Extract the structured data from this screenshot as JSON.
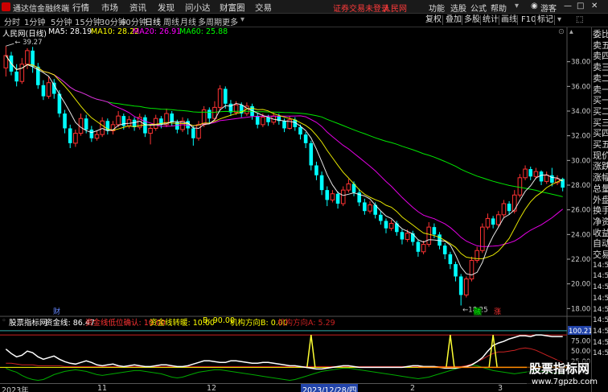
{
  "app": {
    "title": "通达信金融终端",
    "login_notice": "证券交易未登录",
    "user": "人民网",
    "guest": "游客"
  },
  "menu": [
    "行情",
    "市场",
    "资讯",
    "发现",
    "问小达",
    "财富圈",
    "交易"
  ],
  "right_menu": [
    "功能",
    "选股",
    "公式",
    "帮助"
  ],
  "periods": [
    "分时",
    "1分钟",
    "5分钟",
    "15分钟",
    "30分钟",
    "60分钟",
    "日线",
    "周线",
    "月线",
    "多周期",
    "更多"
  ],
  "active_period": "日线",
  "tools": [
    "叠加",
    "多股",
    "统计",
    "画线",
    "F10",
    "标记"
  ],
  "tools_left": "复权",
  "stock": {
    "name": "人民网(日线)"
  },
  "ma": {
    "ma5": {
      "label": "MA5: 28.19",
      "color": "#ffffff"
    },
    "ma10": {
      "label": "MA10: 28.22",
      "color": "#ffff00"
    },
    "ma20": {
      "label": "MA20: 26.91",
      "color": "#ff00ff"
    },
    "ma60": {
      "label": "MA60: 25.88",
      "color": "#00ff00"
    }
  },
  "price_axis": [
    "38.00",
    "36.00",
    "34.00",
    "32.00",
    "30.00",
    "28.00",
    "26.00",
    "24.00",
    "22.00",
    "20.00",
    "18.00"
  ],
  "annotations": {
    "high": "39.27",
    "low": "18.25",
    "cai": "财",
    "rong": "融",
    "zhang": "涨"
  },
  "indicator": {
    "name": "股票指标网",
    "gold_line": "资金线: 86.47",
    "a": "资金线低位确认: 10.00",
    "b": "资金线转暖: 10.00",
    "c": "B: 90.00",
    "d": "机构方向B: 0.00",
    "e": "机构方向A: 5.29",
    "axis": [
      "100.21",
      "75.00",
      "50.00",
      "25.00",
      "0.00"
    ]
  },
  "right_panel": [
    "委比",
    "卖五",
    "卖四",
    "卖三",
    "卖二",
    "卖一",
    "买一",
    "买二",
    "买三",
    "买四",
    "买五",
    "现价",
    "涨跌",
    "涨幅",
    "总量",
    "外盘",
    "换手",
    "净资",
    "收益",
    "自动",
    "交易",
    "14:50",
    "14:50",
    "14:50",
    "14:50",
    "14:50",
    "14:50",
    "14:56",
    "14:56",
    "14:56"
  ],
  "dates": [
    "2023年",
    "11",
    "12",
    "2023/12/28/四",
    "2",
    "3"
  ],
  "watermark": {
    "line1": "股票指标网",
    "line2": "www.7gpzb.com"
  },
  "chart_data": {
    "type": "candlestick",
    "ylim": [
      17.5,
      40
    ],
    "candles": [
      [
        37.5,
        38.5,
        36.8,
        39.27
      ],
      [
        38.5,
        37.2,
        36.9,
        38.8
      ],
      [
        37.2,
        36.4,
        36,
        37.8
      ],
      [
        36.4,
        37.8,
        36.2,
        38.3
      ],
      [
        37.8,
        38.9,
        37.4,
        39.1
      ],
      [
        38.9,
        37.6,
        37.1,
        39.2
      ],
      [
        37.6,
        36.1,
        35.8,
        37.9
      ],
      [
        36.1,
        35.2,
        34.9,
        36.5
      ],
      [
        35.2,
        36.3,
        35,
        36.8
      ],
      [
        36.3,
        35.4,
        35,
        36.6
      ],
      [
        35.4,
        33.8,
        33.5,
        35.7
      ],
      [
        33.8,
        32.6,
        32.2,
        34.1
      ],
      [
        32.6,
        31.4,
        31,
        32.9
      ],
      [
        31.4,
        32.2,
        31.1,
        32.5
      ],
      [
        32.2,
        33.4,
        32,
        33.8
      ],
      [
        33.4,
        32.5,
        32.2,
        33.7
      ],
      [
        32.5,
        31.8,
        31.5,
        32.8
      ],
      [
        31.8,
        32.1,
        31.6,
        32.4
      ],
      [
        32.1,
        33.2,
        31.9,
        33.5
      ],
      [
        33.2,
        32.4,
        32.1,
        33.4
      ],
      [
        32.4,
        32.9,
        32.1,
        33.2
      ],
      [
        32.9,
        33.6,
        32.7,
        34
      ],
      [
        33.6,
        32.8,
        32.5,
        33.8
      ],
      [
        32.8,
        33.3,
        32.6,
        33.6
      ],
      [
        33.3,
        32.7,
        32.4,
        33.5
      ],
      [
        32.7,
        33.5,
        32.5,
        33.8
      ],
      [
        33.5,
        32.2,
        31.9,
        33.7
      ],
      [
        32.2,
        32.6,
        31.3,
        32.9
      ],
      [
        32.6,
        33.4,
        32.4,
        33.7
      ],
      [
        33.4,
        32.9,
        32.6,
        33.6
      ],
      [
        32.9,
        33.8,
        32.7,
        34.2
      ],
      [
        33.8,
        33.1,
        32.8,
        34
      ],
      [
        33.1,
        32.5,
        32.2,
        33.3
      ],
      [
        32.5,
        33.2,
        32.3,
        33.5
      ],
      [
        33.2,
        32.6,
        32.1,
        33.4
      ],
      [
        32.6,
        31.8,
        31.2,
        32.8
      ],
      [
        31.8,
        32.9,
        31.6,
        33.2
      ],
      [
        32.9,
        34.1,
        32.7,
        34.4
      ],
      [
        34.1,
        33.4,
        33,
        34.3
      ],
      [
        33.4,
        34.3,
        33.2,
        34.8
      ],
      [
        34.3,
        35.8,
        34.1,
        36.1
      ],
      [
        35.8,
        34.6,
        34.2,
        36
      ],
      [
        34.6,
        33.9,
        33.6,
        34.9
      ],
      [
        33.9,
        34.5,
        33.7,
        34.8
      ],
      [
        34.5,
        33.8,
        33.5,
        34.7
      ],
      [
        33.8,
        34.4,
        33.6,
        34.7
      ],
      [
        34.4,
        33.6,
        33.3,
        34.6
      ],
      [
        33.6,
        32.9,
        32.6,
        33.8
      ],
      [
        32.9,
        33.5,
        32.7,
        33.8
      ],
      [
        33.5,
        33.1,
        32.8,
        33.7
      ],
      [
        33.1,
        33.6,
        32.9,
        33.9
      ],
      [
        33.6,
        33.2,
        32.9,
        33.8
      ],
      [
        33.2,
        32.6,
        32.3,
        33.4
      ],
      [
        32.6,
        33.3,
        32.5,
        33.6
      ],
      [
        33.3,
        32.7,
        32.4,
        33.5
      ],
      [
        32.7,
        32.1,
        31.7,
        32.9
      ],
      [
        32.1,
        31.4,
        31,
        32.3
      ],
      [
        31.4,
        29.6,
        29.2,
        31.6
      ],
      [
        29.6,
        28.8,
        28.4,
        29.9
      ],
      [
        28.8,
        27.6,
        27.2,
        29.1
      ],
      [
        27.6,
        26.8,
        26.3,
        27.9
      ],
      [
        26.8,
        27.3,
        26.6,
        27.6
      ],
      [
        27.3,
        26.5,
        26.1,
        27.5
      ],
      [
        26.5,
        27.6,
        26.3,
        27.9
      ],
      [
        27.6,
        28.1,
        27.4,
        28.5
      ],
      [
        28.1,
        27.4,
        27.1,
        28.3
      ],
      [
        27.4,
        26.6,
        26.3,
        27.7
      ],
      [
        26.6,
        25.9,
        25.6,
        26.9
      ],
      [
        25.9,
        26.4,
        25.7,
        26.7
      ],
      [
        26.4,
        25.6,
        25.3,
        26.6
      ],
      [
        25.6,
        25.1,
        24.8,
        25.9
      ],
      [
        25.1,
        24.5,
        24.1,
        25.3
      ],
      [
        24.5,
        24.9,
        24.3,
        25.2
      ],
      [
        24.9,
        24.2,
        23.9,
        25.1
      ],
      [
        24.2,
        23.6,
        23.2,
        24.4
      ],
      [
        23.6,
        24.1,
        23.4,
        24.4
      ],
      [
        24.1,
        23.4,
        23.1,
        24.3
      ],
      [
        23.4,
        22.6,
        22.2,
        23.6
      ],
      [
        22.6,
        23.2,
        22.4,
        23.5
      ],
      [
        23.2,
        24.6,
        23,
        25
      ],
      [
        24.6,
        24,
        23.7,
        24.9
      ],
      [
        24,
        23.1,
        22.8,
        24.2
      ],
      [
        23.1,
        22.4,
        22,
        23.3
      ],
      [
        22.4,
        21.6,
        21.2,
        22.6
      ],
      [
        21.6,
        20.6,
        20.2,
        21.8
      ],
      [
        20.6,
        19.1,
        18.25,
        20.8
      ],
      [
        19.1,
        20.4,
        18.9,
        20.6
      ],
      [
        20.4,
        21.9,
        20.2,
        22.2
      ],
      [
        21.9,
        22.7,
        21.7,
        23
      ],
      [
        22.7,
        24.6,
        22.5,
        24.9
      ],
      [
        24.6,
        25.3,
        24.4,
        25.7
      ],
      [
        25.3,
        24.8,
        24.5,
        25.5
      ],
      [
        24.8,
        25.6,
        24.6,
        25.9
      ],
      [
        25.6,
        26.5,
        25.4,
        26.8
      ],
      [
        26.5,
        25.9,
        25.6,
        26.7
      ],
      [
        25.9,
        27.2,
        25.7,
        27.6
      ],
      [
        27.2,
        28.6,
        27,
        28.9
      ],
      [
        28.6,
        29.3,
        28.4,
        29.6
      ],
      [
        29.3,
        28.7,
        28.4,
        29.5
      ],
      [
        28.7,
        29.1,
        28.5,
        29.4
      ],
      [
        29.1,
        28.3,
        28,
        29.2
      ],
      [
        28.3,
        28.8,
        28.1,
        29.1
      ],
      [
        28.8,
        28.2,
        27.9,
        29.4
      ],
      [
        28.2,
        28.5,
        28,
        28.8
      ],
      [
        28.5,
        27.8,
        27.5,
        28.6
      ]
    ],
    "indicator_series": {
      "gold_line": [
        55,
        44,
        36,
        40,
        50,
        46,
        36,
        30,
        34,
        38,
        30,
        24,
        20,
        18,
        22,
        26,
        22,
        16,
        14,
        16,
        18,
        14,
        12,
        14,
        16,
        14,
        12,
        12,
        14,
        16,
        16,
        14,
        12,
        12,
        14,
        18,
        22,
        26,
        26,
        24,
        22,
        22,
        26,
        26,
        24,
        22,
        20,
        20,
        22,
        22,
        20,
        18,
        16,
        14,
        14,
        12,
        10,
        8,
        6,
        6,
        8,
        10,
        12,
        14,
        14,
        12,
        10,
        10,
        10,
        10,
        10,
        10,
        10,
        10,
        10,
        12,
        14,
        14,
        12,
        12,
        12,
        10,
        8,
        8,
        8,
        10,
        12,
        16,
        24,
        34,
        50,
        64,
        70,
        74,
        80,
        84,
        88,
        88,
        86,
        90,
        90,
        88,
        86,
        86,
        86
      ],
      "red_line": [
        20,
        20,
        18,
        16,
        16,
        16,
        14,
        14,
        14,
        14,
        14,
        12,
        12,
        12,
        12,
        12,
        12,
        12,
        12,
        12,
        12,
        12,
        12,
        12,
        12,
        12,
        12,
        12,
        12,
        12,
        12,
        12,
        12,
        12,
        12,
        12,
        12,
        12,
        12,
        12,
        12,
        12,
        12,
        12,
        12,
        12,
        12,
        12,
        12,
        12,
        12,
        12,
        12,
        12,
        12,
        12,
        12,
        12,
        12,
        12,
        12,
        12,
        12,
        12,
        12,
        12,
        12,
        12,
        12,
        12,
        12,
        12,
        12,
        12,
        12,
        12,
        12,
        12,
        12,
        12,
        12,
        12,
        12,
        12,
        12,
        12,
        14,
        18,
        24,
        30,
        38,
        44,
        48,
        48,
        50,
        52,
        56,
        58,
        56,
        52,
        46,
        40,
        34,
        28,
        22
      ],
      "green_line": [
        8,
        2,
        -2,
        -10,
        -16,
        -20,
        -22,
        -20,
        -14,
        -8,
        -4,
        0,
        2,
        4,
        2,
        0,
        -4,
        -8,
        -10,
        -8,
        -6,
        -4,
        -2,
        0,
        2,
        2,
        0,
        -2,
        -4,
        -6,
        -10,
        -14,
        -16,
        -14,
        -10,
        -6,
        -2,
        0,
        2,
        4,
        4,
        2,
        0,
        -2,
        -4,
        -6,
        -8,
        -10,
        -12,
        -14,
        -16,
        -18,
        -20,
        -22,
        -20,
        -16,
        -12,
        -8,
        -4,
        0,
        2,
        4,
        6,
        8,
        8,
        6,
        4,
        2,
        0,
        -2,
        -4,
        -6,
        -8,
        -10,
        -12,
        -14,
        -16,
        -18,
        -16,
        -14,
        -10,
        -6,
        -2,
        2,
        6,
        10,
        14,
        16,
        14,
        10,
        6,
        2,
        0,
        -2,
        -4,
        -6,
        -4,
        -2,
        0,
        2,
        0,
        -2,
        -4,
        -4,
        -6
      ],
      "spikes": [
        57,
        83,
        91
      ],
      "hlines": [
        100.21,
        90,
        10
      ]
    }
  }
}
